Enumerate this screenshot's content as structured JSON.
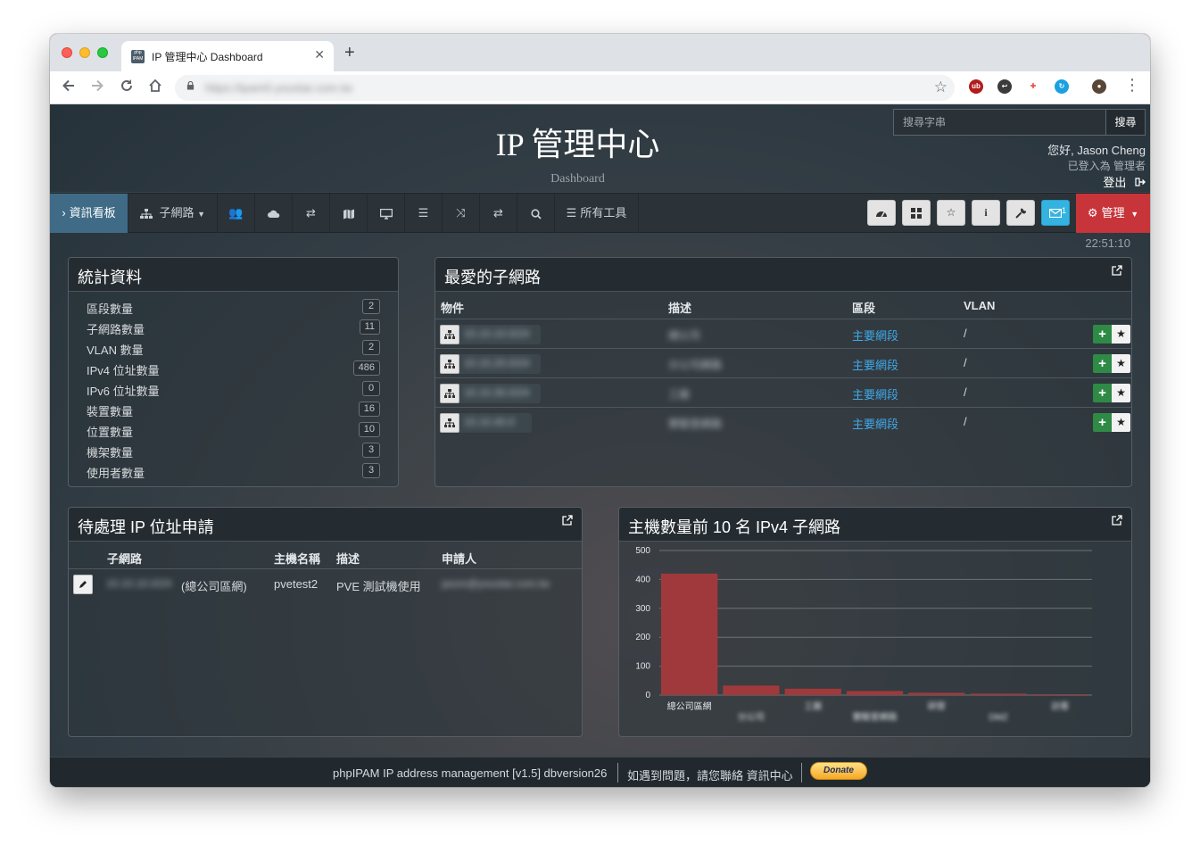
{
  "browser": {
    "tab_title": "IP 管理中心 Dashboard",
    "favicon_text": "php IPAM",
    "url": "https://ipam0.youstar.com.tw"
  },
  "header": {
    "title": "IP 管理中心",
    "subtitle": "Dashboard",
    "search_placeholder": "搜尋字串",
    "search_button": "搜尋",
    "greeting": "您好, Jason Cheng",
    "logged_in_as": "已登入為  管理者",
    "logout": "登出"
  },
  "nav": {
    "dashboard": "資訊看板",
    "subnets": "子網路",
    "all_tools": "所有工具",
    "admin": "管理",
    "mail_badge": "1"
  },
  "clock": "22:51:10",
  "stats": {
    "title": "統計資料",
    "rows": [
      {
        "label": "區段數量",
        "value": "2"
      },
      {
        "label": "子網路數量",
        "value": "11"
      },
      {
        "label": "VLAN 數量",
        "value": "2"
      },
      {
        "label": "IPv4 位址數量",
        "value": "486"
      },
      {
        "label": "IPv6 位址數量",
        "value": "0"
      },
      {
        "label": "裝置數量",
        "value": "16"
      },
      {
        "label": "位置數量",
        "value": "10"
      },
      {
        "label": "機架數量",
        "value": "3"
      },
      {
        "label": "使用者數量",
        "value": "3"
      }
    ]
  },
  "favorites": {
    "title": "最愛的子網路",
    "headers": {
      "object": "物件",
      "description": "描述",
      "section": "區段",
      "vlan": "VLAN"
    },
    "rows": [
      {
        "object": "10.10.10.0/24",
        "description": "總公司",
        "section": "主要網段",
        "vlan": "/"
      },
      {
        "object": "10.10.20.0/24",
        "description": "分公司網路",
        "section": "主要網段",
        "vlan": "/"
      },
      {
        "object": "10.10.30.0/24",
        "description": "工廠",
        "section": "主要網段",
        "vlan": "/"
      },
      {
        "object": "10.10.40.0",
        "description": "實驗室網路",
        "section": "主要網段",
        "vlan": "/"
      }
    ]
  },
  "requests": {
    "title": "待處理 IP 位址申請",
    "headers": {
      "subnet": "子網路",
      "hostname": "主機名稱",
      "description": "描述",
      "requester": "申請人"
    },
    "rows": [
      {
        "subnet_blur": "10.10.10.0/24",
        "subnet_label": "(總公司區網)",
        "hostname": "pvetest2",
        "description": "PVE 測試機使用",
        "requester": "jason@youstar.com.tw"
      }
    ]
  },
  "top_hosts": {
    "title": "主機數量前 10 名 IPv4 子網路"
  },
  "chart_data": {
    "type": "bar",
    "categories": [
      "總公司區網",
      "分公司",
      "工廠",
      "實驗室網路",
      "研發",
      "DMZ",
      "訪客"
    ],
    "values": [
      420,
      33,
      22,
      14,
      8,
      5,
      3
    ],
    "ylim": [
      0,
      500
    ],
    "yticks": [
      0,
      100,
      200,
      300,
      400,
      500
    ],
    "grid": true,
    "color": "#a0393b"
  },
  "footer": {
    "version": "phpIPAM IP address management [v1.5] dbversion26",
    "contact": "如遇到問題，請您聯絡 資訊中心",
    "donate": "Donate"
  }
}
